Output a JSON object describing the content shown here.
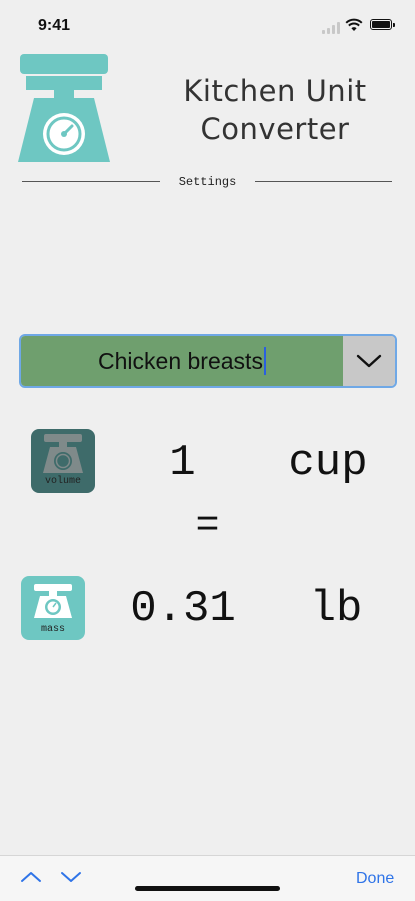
{
  "status_bar": {
    "time": "9:41"
  },
  "header": {
    "title_line1": "Kitchen Unit",
    "title_line2": "Converter",
    "settings_label": "Settings"
  },
  "converter": {
    "ingredient": "Chicken breasts",
    "from": {
      "icon_caption": "volume",
      "amount": "1",
      "unit": "cup"
    },
    "equals": "=",
    "to": {
      "icon_caption": "mass",
      "amount": "0.31",
      "unit": "lb"
    }
  },
  "keyboard_toolbar": {
    "done_label": "Done"
  },
  "icons": {
    "logo": "kitchen-scale-icon",
    "dropdown": "chevron-down-icon",
    "prev": "chevron-up-icon",
    "next": "chevron-down-icon"
  },
  "colors": {
    "accent": "#6ec7c2",
    "volume_icon_bg": "#3e6b6a",
    "ingredient_field_bg": "#6f9f6e",
    "focus_border": "#6fa8e6",
    "done_blue": "#2f74e8"
  }
}
